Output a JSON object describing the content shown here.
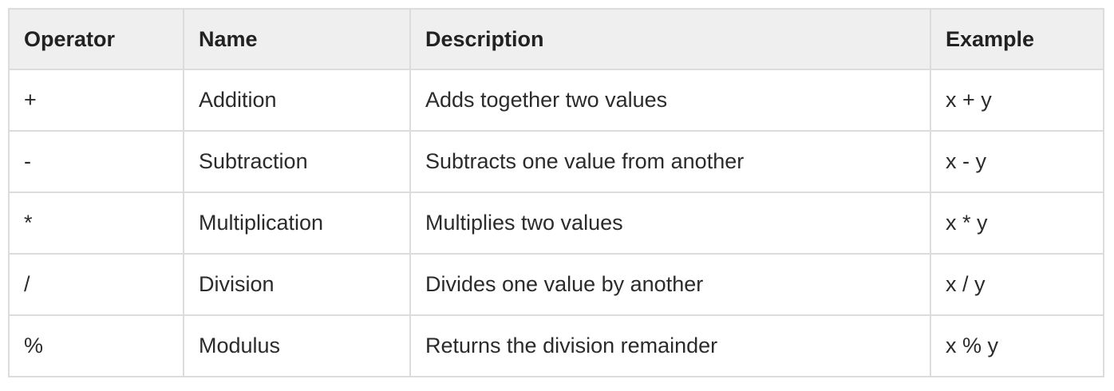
{
  "table": {
    "headers": [
      "Operator",
      "Name",
      "Description",
      "Example"
    ],
    "rows": [
      [
        "+",
        "Addition",
        "Adds together two values",
        "x + y"
      ],
      [
        "-",
        "Subtraction",
        "Subtracts one value from another",
        "x - y"
      ],
      [
        "*",
        "Multiplication",
        "Multiplies two values",
        "x * y"
      ],
      [
        "/",
        "Division",
        "Divides one value by another",
        "x / y"
      ],
      [
        "%",
        "Modulus",
        "Returns the division remainder",
        "x % y"
      ]
    ]
  },
  "colors": {
    "header_background": "#efefef",
    "border": "#dcdcdc",
    "text": "#2b2b2b"
  }
}
